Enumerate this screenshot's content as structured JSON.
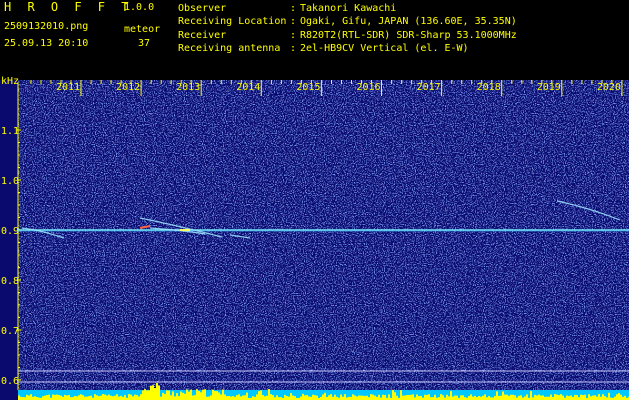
{
  "header": {
    "app_title": "H R O F F T",
    "app_version": "1.0.0",
    "file_name": "2509132010.png",
    "timestamp": "25.09.13 20:10",
    "meteor_label": "meteor",
    "meteor_count": "37",
    "info": [
      {
        "key": "Observer",
        "sep": ":",
        "value": "Takanori Kawachi"
      },
      {
        "key": "Receiving Location",
        "sep": ":",
        "value": "Ogaki, Gifu, JAPAN (136.60E, 35.35N)"
      },
      {
        "key": "Receiver",
        "sep": ":",
        "value": "R820T2(RTL-SDR) SDR-Sharp 53.1000MHz"
      },
      {
        "key": "Receiving antenna",
        "sep": ":",
        "value": "2el-HB9CV Vertical (el. E-W)"
      }
    ]
  },
  "chart_data": {
    "type": "heatmap",
    "ylabel": "kHz",
    "x_ticks": [
      "2011",
      "2012",
      "2013",
      "2014",
      "2015",
      "2016",
      "2017",
      "2018",
      "2019",
      "2020"
    ],
    "y_ticks": [
      "1.1",
      "1.0",
      "0.9",
      "0.8",
      "0.7",
      "0.6"
    ],
    "ylim": [
      0.6,
      1.15
    ],
    "carrier_khz": 0.9,
    "colors": {
      "background": "#0a0a6e",
      "noise": "#2a46d8",
      "carrier": "#7fffff",
      "axis": "#ffff00",
      "meteor_trail": "#9fe8ff",
      "level_bar": "#ffff00",
      "level_base": "#00c8ff"
    }
  }
}
